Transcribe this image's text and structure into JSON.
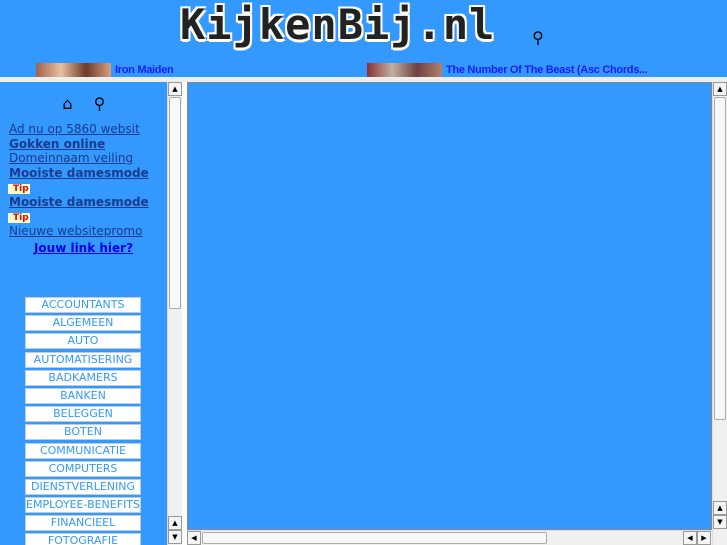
{
  "header": {
    "logo": "KijkenBij.nl",
    "search_icon": "key-magnifier-icon"
  },
  "news": [
    {
      "title": "Iron Maiden"
    },
    {
      "title": "The Number Of The Beast (Asc Chords..."
    }
  ],
  "sidebar": {
    "icons": [
      "home-icon",
      "search-icon"
    ],
    "links": [
      {
        "label": "Ad nu op 5860 websit",
        "bold": false
      },
      {
        "label": "Gokken online",
        "bold": true
      },
      {
        "label": "Domeinnaam veiling",
        "bold": false
      },
      {
        "label": "Mooiste damesmode",
        "bold": true,
        "tip": "Tip"
      },
      {
        "label": "Mooiste damesmode",
        "bold": true,
        "tip": "Tip"
      },
      {
        "label": "Nieuwe websitepromo",
        "bold": false
      }
    ],
    "cta": "Jouw link hier?",
    "categories": [
      "ACCOUNTANTS",
      "ALGEMEEN",
      "AUTO",
      "AUTOMATISERING",
      "BADKAMERS",
      "BANKEN",
      "BELEGGEN",
      "BOTEN",
      "COMMUNICATIE",
      "COMPUTERS",
      "DIENSTVERLENING",
      "EMPLOYEE-BENEFITS",
      "FINANCIEEL",
      "FOTOGRAFIE"
    ]
  },
  "colors": {
    "background": "#3399ff",
    "link": "#1a3a8c",
    "category_text": "#3399ff"
  }
}
